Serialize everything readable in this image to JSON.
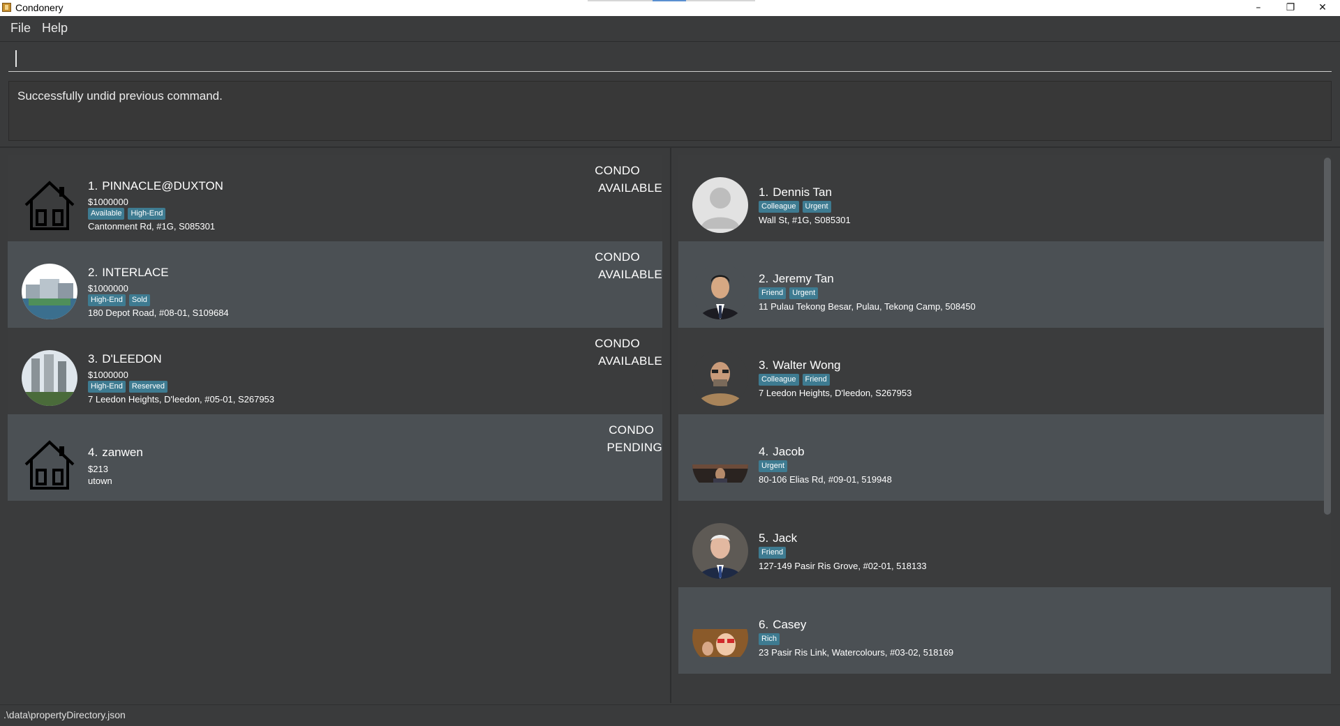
{
  "window": {
    "title": "Condonery",
    "minimize": "–",
    "restore": "❐",
    "close": "✕"
  },
  "menu": {
    "file": "File",
    "help": "Help"
  },
  "command": {
    "value": ""
  },
  "result": {
    "message": "Successfully undid previous command."
  },
  "properties": [
    {
      "index": "1.",
      "name": "PINNACLE@DUXTON",
      "price": "$1000000",
      "tags": [
        "Available",
        "High-End"
      ],
      "address": "Cantonment Rd, #1G, S085301",
      "type": "CONDO",
      "status": "AVAILABLE",
      "image": "house-icon"
    },
    {
      "index": "2.",
      "name": "INTERLACE",
      "price": "$1000000",
      "tags": [
        "High-End",
        "Sold"
      ],
      "address": "180 Depot Road, #08-01, S109684",
      "type": "CONDO",
      "status": "AVAILABLE",
      "image": "interlace-photo"
    },
    {
      "index": "3.",
      "name": "D'LEEDON",
      "price": "$1000000",
      "tags": [
        "High-End",
        "Reserved"
      ],
      "address": "7 Leedon Heights, D'leedon, #05-01, S267953",
      "type": "CONDO",
      "status": "AVAILABLE",
      "image": "dleedon-photo"
    },
    {
      "index": "4.",
      "name": "zanwen",
      "price": "$213",
      "tags": [],
      "address": "utown",
      "type": "CONDO",
      "status": "PENDING",
      "image": "house-icon"
    }
  ],
  "clients": [
    {
      "index": "1.",
      "name": "Dennis Tan",
      "tags": [
        "Colleague",
        "Urgent"
      ],
      "address": "Wall St, #1G, S085301",
      "image": "default-avatar"
    },
    {
      "index": "2.",
      "name": "Jeremy Tan",
      "tags": [
        "Friend",
        "Urgent"
      ],
      "address": "11 Pulau Tekong Besar, Pulau, Tekong Camp, 508450",
      "image": "photo-avatar"
    },
    {
      "index": "3.",
      "name": "Walter Wong",
      "tags": [
        "Colleague",
        "Friend"
      ],
      "address": "7 Leedon Heights, D'leedon, S267953",
      "image": "photo-avatar"
    },
    {
      "index": "4.",
      "name": "Jacob",
      "tags": [
        "Urgent"
      ],
      "address": "80-106 Elias Rd, #09-01, 519948",
      "image": "photo-avatar"
    },
    {
      "index": "5.",
      "name": "Jack",
      "tags": [
        "Friend"
      ],
      "address": "127-149 Pasir Ris Grove, #02-01, 518133",
      "image": "photo-avatar"
    },
    {
      "index": "6.",
      "name": "Casey",
      "tags": [
        "Rich"
      ],
      "address": "23 Pasir Ris Link, Watercolours, #03-02, 518169",
      "image": "photo-avatar"
    }
  ],
  "status_bar": {
    "path": ".\\data\\propertyDirectory.json"
  },
  "colors": {
    "background": "#3a3b3c",
    "card_alt": "#4b5054",
    "tag": "#3e7b91"
  }
}
